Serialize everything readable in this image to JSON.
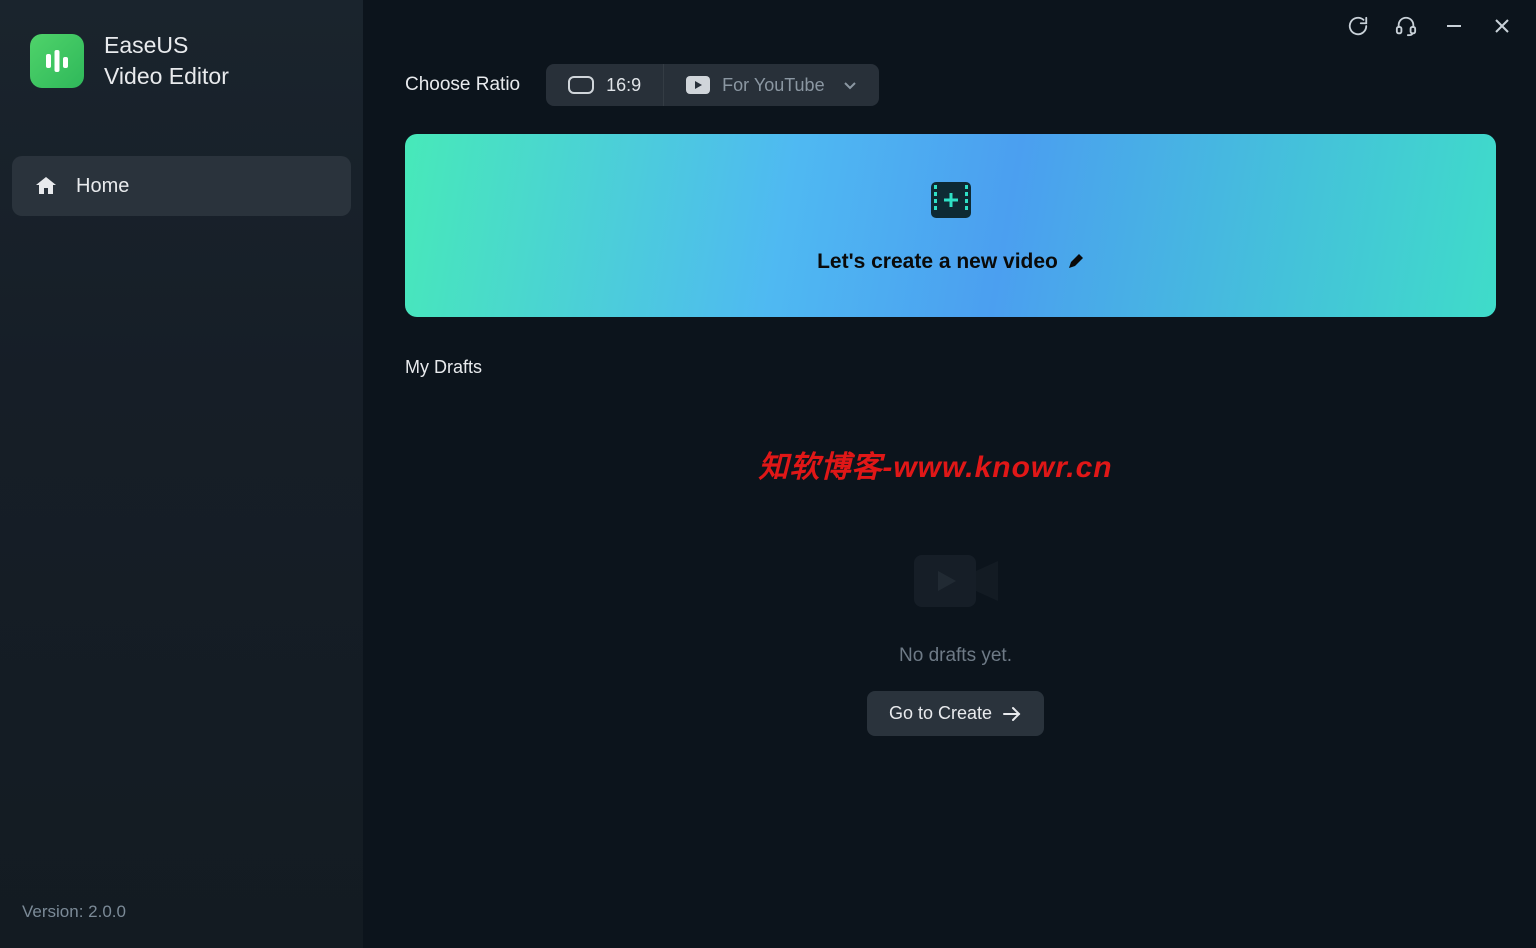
{
  "sidebar": {
    "brand": {
      "line1": "EaseUS",
      "line2": "Video Editor"
    },
    "nav": {
      "home_label": "Home"
    },
    "version_label": "Version: 2.0.0"
  },
  "main": {
    "ratio_label": "Choose Ratio",
    "ratio_value": "16:9",
    "youtube_label": "For YouTube",
    "create_label": "Let's create a new video",
    "drafts_title": "My Drafts",
    "empty_text": "No drafts yet.",
    "goto_label": "Go to Create",
    "watermark": "知软博客-www.knowr.cn"
  }
}
